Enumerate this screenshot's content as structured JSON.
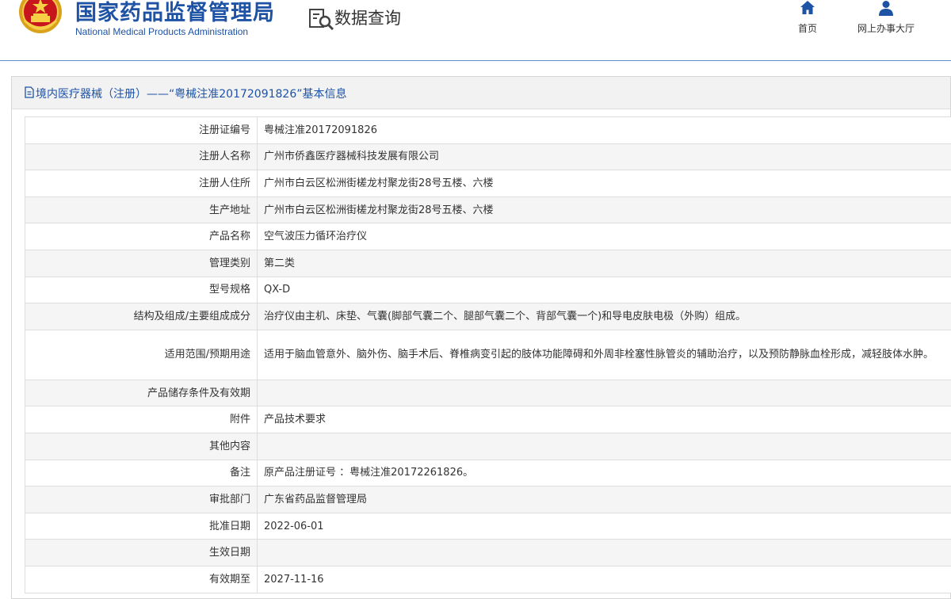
{
  "header": {
    "title": "国家药品监督管理局",
    "subtitle": "National Medical Products Administration",
    "section_title": "数据查询",
    "emblem_icon": "national-emblem-icon",
    "brand_color": "#1e52a4",
    "nav": [
      {
        "label": "首页",
        "icon": "home-icon"
      },
      {
        "label": "网上办事大厅",
        "icon": "user-icon"
      }
    ]
  },
  "panel": {
    "title": "境内医疗器械（注册）——“粤械注准20172091826”基本信息",
    "rows": [
      {
        "key": "注册证编号",
        "value": "粤械注准20172091826"
      },
      {
        "key": "注册人名称",
        "value": "广州市侨鑫医疗器械科技发展有限公司"
      },
      {
        "key": "注册人住所",
        "value": "广州市白云区松洲街槎龙村聚龙街28号五楼、六楼"
      },
      {
        "key": "生产地址",
        "value": "广州市白云区松洲街槎龙村聚龙街28号五楼、六楼"
      },
      {
        "key": "产品名称",
        "value": "空气波压力循环治疗仪"
      },
      {
        "key": "管理类别",
        "value": "第二类"
      },
      {
        "key": "型号规格",
        "value": "QX-D"
      },
      {
        "key": "结构及组成/主要组成成分",
        "value": "治疗仪由主机、床垫、气囊(脚部气囊二个、腿部气囊二个、背部气囊一个)和导电皮肤电极（外购）组成。"
      },
      {
        "key": "适用范围/预期用途",
        "value": "适用于脑血管意外、脑外伤、脑手术后、脊椎病变引起的肢体功能障碍和外周非栓塞性脉管炎的辅助治疗，以及预防静脉血栓形成，减轻肢体水肿。"
      },
      {
        "key": "产品储存条件及有效期",
        "value": ""
      },
      {
        "key": "附件",
        "value": "产品技术要求"
      },
      {
        "key": "其他内容",
        "value": ""
      },
      {
        "key": "备注",
        "value": "原产品注册证号 ：粤械注准20172261826。"
      },
      {
        "key": "审批部门",
        "value": "广东省药品监督管理局"
      },
      {
        "key": "批准日期",
        "value": "2022-06-01"
      },
      {
        "key": "生效日期",
        "value": ""
      },
      {
        "key": "有效期至",
        "value": "2027-11-16"
      }
    ]
  }
}
